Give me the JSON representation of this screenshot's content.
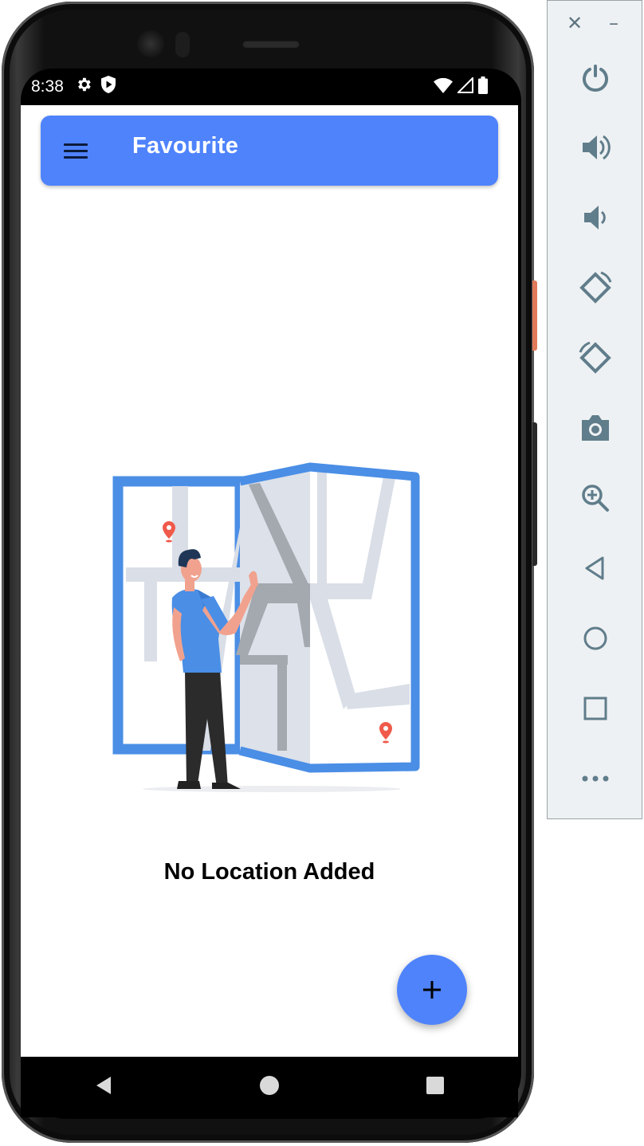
{
  "status_bar": {
    "time": "8:38",
    "left_icons": [
      "gear-icon",
      "play-protect-icon"
    ],
    "right_icons": [
      "wifi-icon",
      "signal-icon",
      "battery-icon"
    ]
  },
  "app_bar": {
    "title": "Favourite",
    "menu_icon": "hamburger-menu-icon",
    "background": "#4f83fc"
  },
  "empty_state": {
    "illustration": "person-with-map-illustration",
    "message": "No Location Added"
  },
  "fab": {
    "icon": "plus-icon",
    "color": "#4f83fc"
  },
  "nav_bar": {
    "buttons": [
      "back-icon",
      "home-icon",
      "recents-icon"
    ]
  },
  "emulator_panel": {
    "window_controls": [
      "close-icon",
      "minimize-icon"
    ],
    "tools": [
      "power-icon",
      "volume-up-icon",
      "volume-down-icon",
      "rotate-left-icon",
      "rotate-right-icon",
      "camera-icon",
      "zoom-icon",
      "back-icon",
      "home-icon",
      "overview-icon",
      "more-icon"
    ],
    "icon_color": "#607d8b"
  }
}
